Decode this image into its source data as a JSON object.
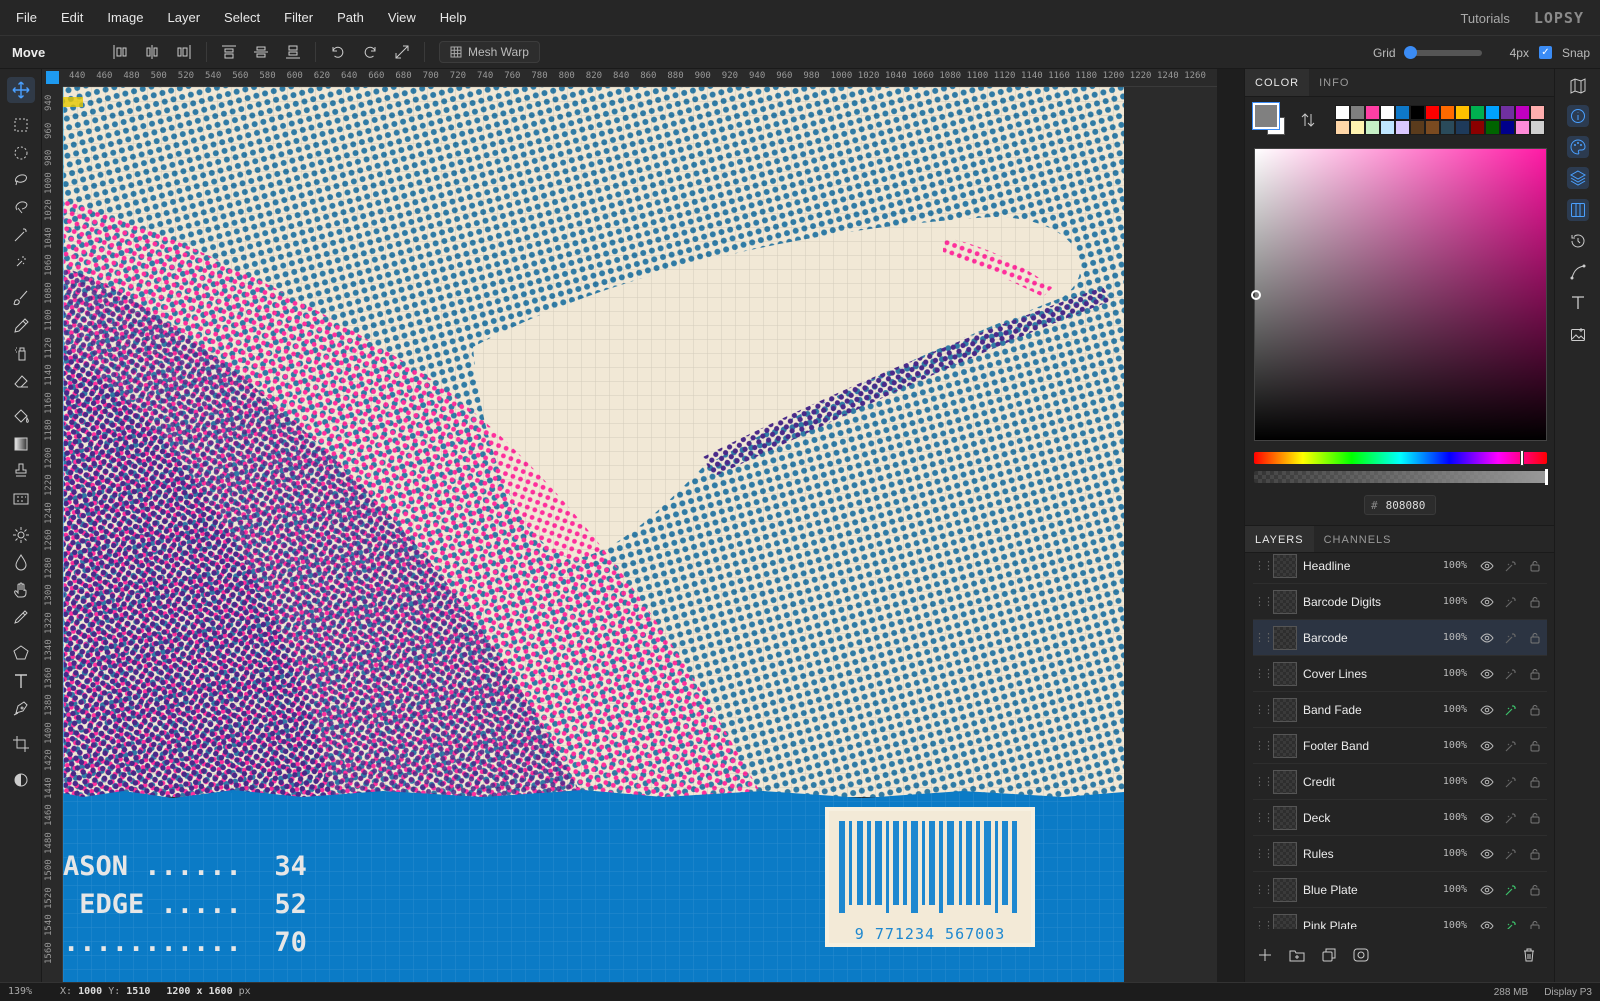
{
  "menubar": {
    "items": [
      "File",
      "Edit",
      "Image",
      "Layer",
      "Select",
      "Filter",
      "Path",
      "View",
      "Help"
    ],
    "tutorials": "Tutorials",
    "logo": "LOPSY"
  },
  "options": {
    "tool_name": "Move",
    "mesh_warp": "Mesh Warp",
    "grid_label": "Grid",
    "grid_value": 0,
    "grid_size": "4px",
    "snap_label": "Snap",
    "snap_checked": true
  },
  "rulers": {
    "top": [
      "440",
      "460",
      "480",
      "500",
      "520",
      "540",
      "560",
      "580",
      "600",
      "620",
      "640",
      "660",
      "680",
      "700",
      "720",
      "740",
      "760",
      "780",
      "800",
      "820",
      "840",
      "860",
      "880",
      "900",
      "920",
      "940",
      "960",
      "980",
      "1000",
      "1020",
      "1040",
      "1060",
      "1080",
      "1100",
      "1120",
      "1140",
      "1160",
      "1180",
      "1200",
      "1220",
      "1240",
      "1260"
    ],
    "left": [
      "940",
      "960",
      "980",
      "1000",
      "1020",
      "1040",
      "1060",
      "1080",
      "1100",
      "1120",
      "1140",
      "1160",
      "1180",
      "1200",
      "1220",
      "1240",
      "1260",
      "1280",
      "1300",
      "1320",
      "1340",
      "1360",
      "1380",
      "1400",
      "1420",
      "1440",
      "1460",
      "1480",
      "1500",
      "1520",
      "1540",
      "1560"
    ]
  },
  "artwork": {
    "stats": [
      {
        "label": "ASON ......",
        "value": "34"
      },
      {
        "label": " EDGE .....",
        "value": "52"
      },
      {
        "label": "...........",
        "value": "70"
      }
    ],
    "barcode_digits": "9 771234 567003"
  },
  "panel": {
    "tabs": [
      "COLOR",
      "INFO"
    ],
    "foreground": "#808080",
    "background": "#ffffff",
    "hex_value": "808080",
    "hex_prefix": "#",
    "palette": [
      "#ffffff",
      "#7f7f7f",
      "#ff3fa4",
      "#ffffff",
      "#0e78c8",
      "#000000",
      "#ff0000",
      "#ff6a00",
      "#ffc000",
      "#00b050",
      "#00a2ff",
      "#7030a0",
      "#c000c0",
      "#ffaeae",
      "#ffd7a8",
      "#fff3b0",
      "#c6f0c6",
      "#bfe6ff",
      "#d9c8ff",
      "#5a3b1c",
      "#7a4a20",
      "#2a4a5a",
      "#1e3a5a",
      "#8b0000",
      "#006400",
      "#00008b",
      "#ff8ad8",
      "#cfcfcf"
    ]
  },
  "layers": {
    "tabs": [
      "LAYERS",
      "CHANNELS"
    ],
    "items": [
      {
        "name": "Headline",
        "opacity": "100%",
        "fx": false,
        "selected": false
      },
      {
        "name": "Barcode Digits",
        "opacity": "100%",
        "fx": false,
        "selected": false
      },
      {
        "name": "Barcode",
        "opacity": "100%",
        "fx": false,
        "selected": true
      },
      {
        "name": "Cover Lines",
        "opacity": "100%",
        "fx": false,
        "selected": false
      },
      {
        "name": "Band Fade",
        "opacity": "100%",
        "fx": true,
        "selected": false
      },
      {
        "name": "Footer Band",
        "opacity": "100%",
        "fx": false,
        "selected": false
      },
      {
        "name": "Credit",
        "opacity": "100%",
        "fx": false,
        "selected": false
      },
      {
        "name": "Deck",
        "opacity": "100%",
        "fx": false,
        "selected": false
      },
      {
        "name": "Rules",
        "opacity": "100%",
        "fx": false,
        "selected": false
      },
      {
        "name": "Blue Plate",
        "opacity": "100%",
        "fx": true,
        "selected": false
      },
      {
        "name": "Pink Plate",
        "opacity": "100%",
        "fx": true,
        "selected": false
      }
    ]
  },
  "status": {
    "zoom": "139%",
    "x_label": "X:",
    "x": "1000",
    "y_label": "Y:",
    "y": "1510",
    "doc_size": "1200 x 1600",
    "doc_unit": "px",
    "memory": "288 MB",
    "color_profile": "Display P3"
  },
  "colors": {
    "accent": "#3b8cf5",
    "band_blue": "#0b7bc6",
    "paper": "#f1e8d6",
    "halftone_blue": "#1a6fa0",
    "halftone_pink": "#ff2f9c",
    "halftone_navy": "#4a2a8a",
    "fx_green": "#3cc06a"
  }
}
